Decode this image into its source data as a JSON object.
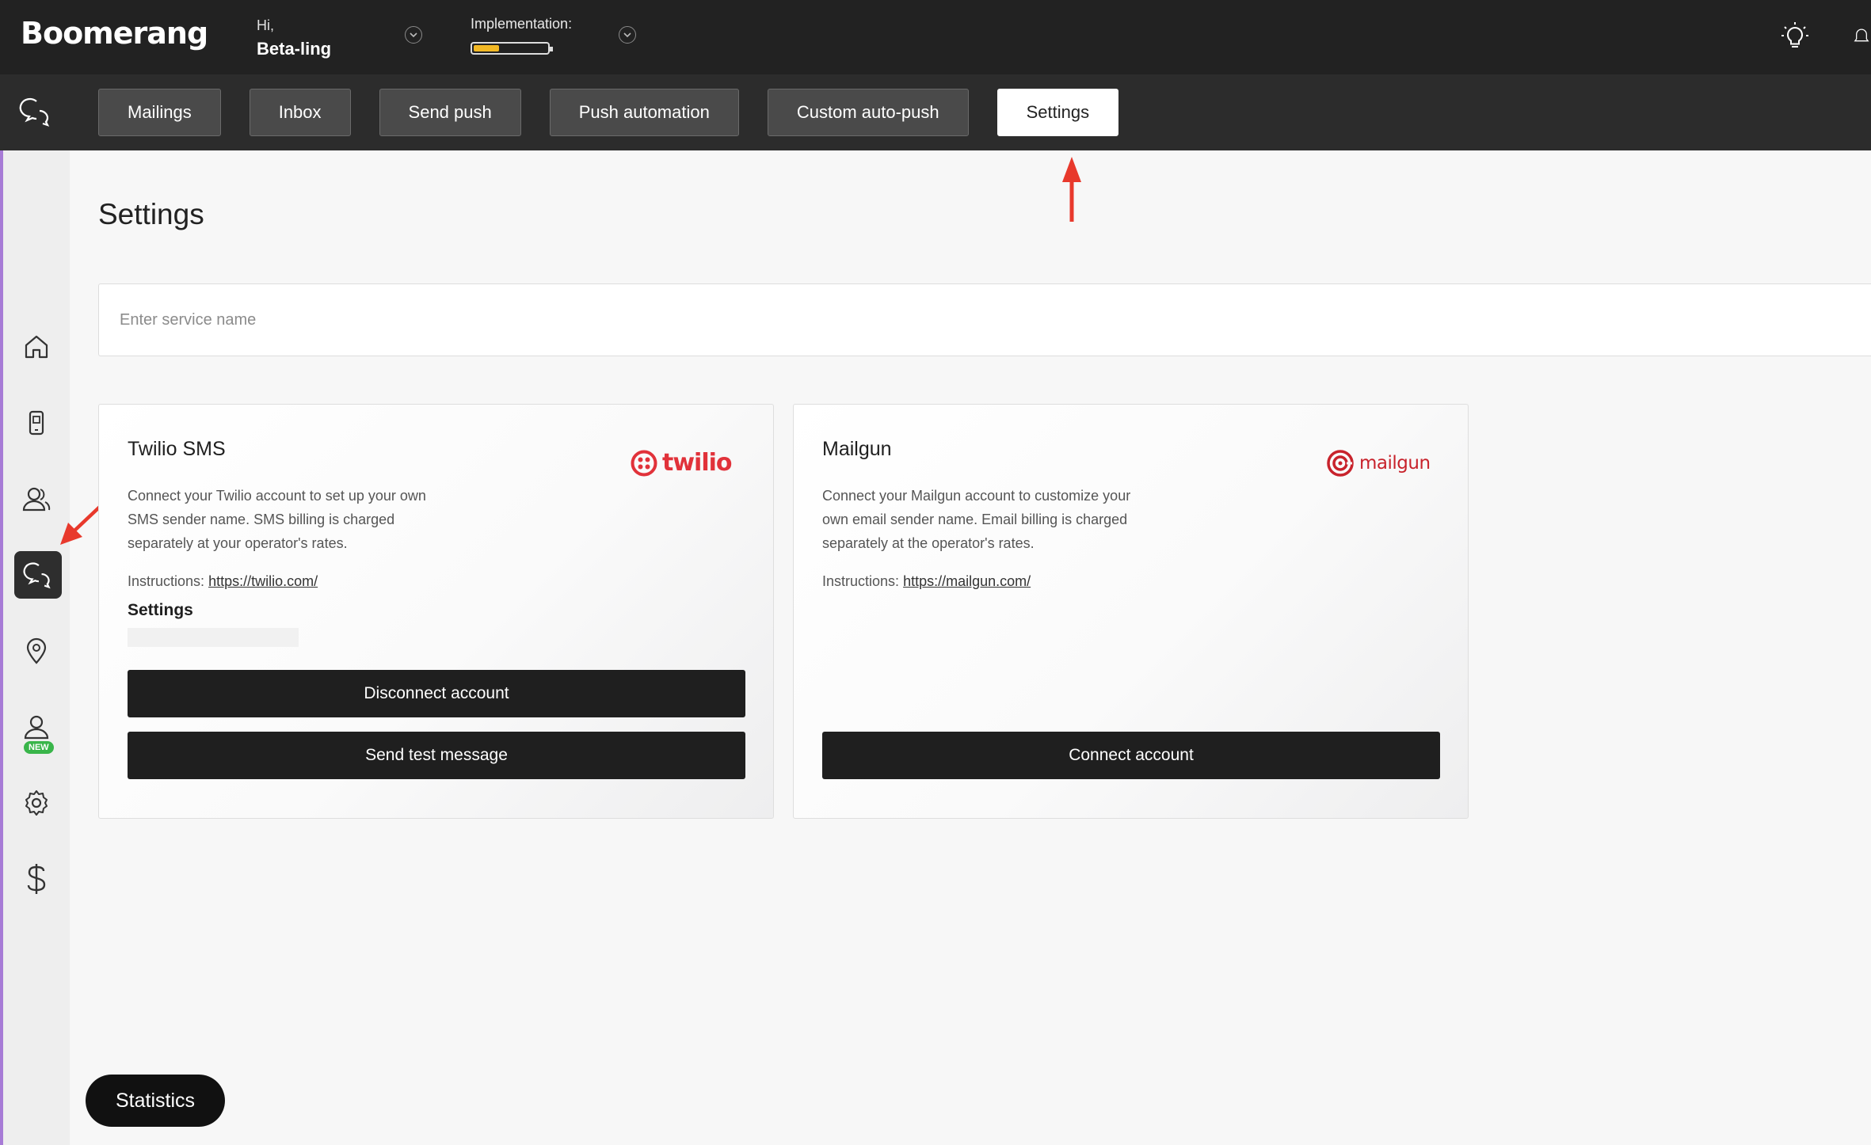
{
  "brand": {
    "logo_text": "Boomerang"
  },
  "header": {
    "greeting": "Hi,",
    "user_name": "Beta-ling",
    "implementation_label": "Implementation:",
    "implementation_progress": 0.35,
    "icons": [
      "lightbulb-icon",
      "bell-icon"
    ]
  },
  "subnav": {
    "tabs": [
      {
        "label": "Mailings",
        "active": false
      },
      {
        "label": "Inbox",
        "active": false
      },
      {
        "label": "Send push",
        "active": false
      },
      {
        "label": "Push automation",
        "active": false
      },
      {
        "label": "Custom auto-push",
        "active": false
      },
      {
        "label": "Settings",
        "active": true
      }
    ]
  },
  "sidebar": {
    "items": [
      {
        "icon": "home-icon"
      },
      {
        "icon": "mobile-icon"
      },
      {
        "icon": "users-icon"
      },
      {
        "icon": "chat-icon",
        "selected": true,
        "badge": "NEW"
      },
      {
        "icon": "location-pin-icon"
      },
      {
        "icon": "user-icon"
      },
      {
        "icon": "gear-icon"
      },
      {
        "icon": "dollar-icon"
      }
    ]
  },
  "main": {
    "title": "Settings",
    "search_placeholder": "Enter service name",
    "cards": [
      {
        "title": "Twilio SMS",
        "logo_text": "twilio",
        "description": "Connect your Twilio account to set up your own SMS sender name. SMS billing is charged separately at your operator's rates.",
        "instructions_label": "Instructions:",
        "instructions_link": "https://twilio.com/",
        "settings_label": "Settings",
        "buttons": [
          "Disconnect account",
          "Send test message"
        ]
      },
      {
        "title": "Mailgun",
        "logo_text": "mailgun",
        "description": "Connect your Mailgun account to customize your own email sender name. Email billing is charged separately at the operator's rates.",
        "instructions_label": "Instructions:",
        "instructions_link": "https://mailgun.com/",
        "buttons": [
          "Connect account"
        ]
      }
    ]
  },
  "footer": {
    "statistics_label": "Statistics"
  },
  "colors": {
    "topbar": "#222222",
    "subnav": "#2c2c2c",
    "accent_rail": "#a77bd6",
    "progress": "#f2b824",
    "brand_red": "#e1323a",
    "annotation_arrow": "#e8392c",
    "badge_green": "#39b54a"
  }
}
